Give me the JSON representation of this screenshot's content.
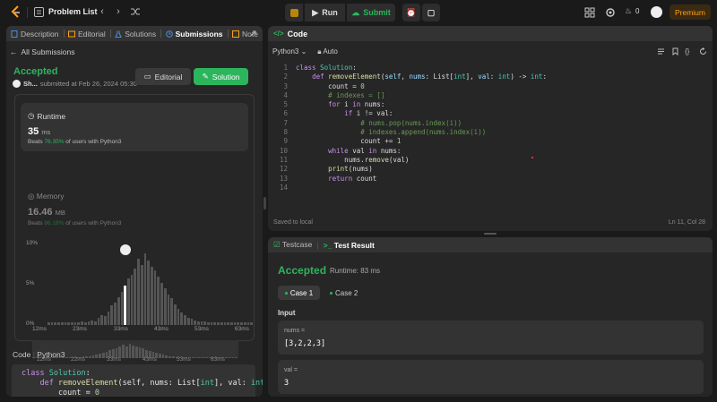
{
  "topbar": {
    "title": "Problem List",
    "run_label": "Run",
    "submit_label": "Submit",
    "streak": "0",
    "premium_label": "Premium"
  },
  "left": {
    "tabs": [
      {
        "label": "Description",
        "icon": "description-icon"
      },
      {
        "label": "Editorial",
        "icon": "book-icon"
      },
      {
        "label": "Solutions",
        "icon": "flask-icon"
      },
      {
        "label": "Submissions",
        "icon": "history-icon"
      },
      {
        "label": "Note",
        "icon": "note-icon"
      }
    ],
    "back_label": "All Submissions",
    "status": "Accepted",
    "user": "Sh...",
    "submitted_text": "submitted at Feb 26, 2024 05:30",
    "editorial_btn": "Editorial",
    "solution_btn": "Solution",
    "runtime": {
      "label": "Runtime",
      "value": "35",
      "unit": "ms",
      "beats_prefix": "Beats",
      "beats_pct": "76.35%",
      "beats_suffix": "of users with Python3"
    },
    "memory": {
      "label": "Memory",
      "value": "16.46",
      "unit": "MB",
      "beats_prefix": "Beats",
      "beats_pct": "86.18%",
      "beats_suffix": "of users with Python3"
    },
    "chart_data": {
      "type": "bar",
      "ylabels": [
        "10%",
        "5%",
        "0%"
      ],
      "xlabels": [
        "12ms",
        "23ms",
        "33ms",
        "43ms",
        "53ms",
        "63ms"
      ],
      "mini_xlabels": [
        "12ms",
        "22ms",
        "33ms",
        "43ms",
        "53ms",
        "63ms"
      ],
      "ylim": [
        0,
        10
      ],
      "values": [
        0.3,
        0.3,
        0.3,
        0.3,
        0.3,
        0.3,
        0.3,
        0.3,
        0.3,
        0.3,
        0.4,
        0.3,
        0.4,
        0.6,
        0.5,
        0.9,
        1.2,
        1.1,
        1.7,
        2.4,
        2.8,
        3.5,
        4.1,
        4.9,
        5.8,
        6.2,
        7.0,
        8.2,
        7.5,
        8.9,
        8.0,
        7.2,
        6.8,
        6.0,
        5.2,
        4.6,
        3.8,
        3.3,
        2.6,
        2.0,
        1.6,
        1.2,
        0.9,
        0.8,
        0.6,
        0.5,
        0.4,
        0.4,
        0.3,
        0.3,
        0.3,
        0.3,
        0.3,
        0.3,
        0.3,
        0.3,
        0.3,
        0.3,
        0.3,
        0.3,
        0.3,
        0.3
      ],
      "highlight_index": 23
    },
    "code_header": "Code",
    "code_lang": "Python3",
    "code_preview": [
      "class Solution:",
      "    def removeElement(self, nums: List[int], val: int)",
      "        count = 0"
    ]
  },
  "code": {
    "title": "Code",
    "lang": "Python3",
    "mode": "Auto",
    "line_numbers": [
      "1",
      "2",
      "3",
      "4",
      "5",
      "6",
      "7",
      "8",
      "9",
      "10",
      "11",
      "12",
      "13",
      "14"
    ],
    "saved": "Saved to local",
    "cursor": "Ln 11, Col 28"
  },
  "test": {
    "tab1": "Testcase",
    "tab2": "Test Result",
    "status": "Accepted",
    "runtime": "Runtime: 83 ms",
    "case1": "Case 1",
    "case2": "Case 2",
    "input_label": "Input",
    "inputs": [
      {
        "name": "nums =",
        "value": "[3,2,2,3]"
      },
      {
        "name": "val =",
        "value": "3"
      }
    ]
  }
}
